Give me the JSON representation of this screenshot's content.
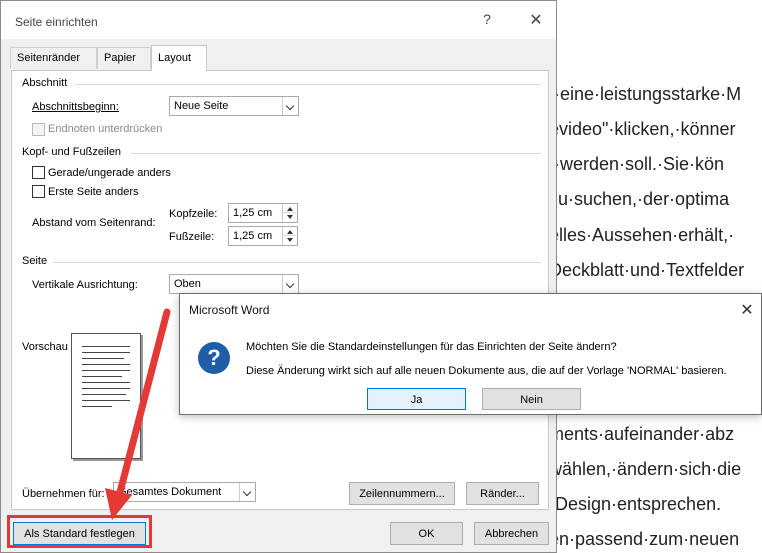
{
  "document": {
    "lines": [
      "t·eine·leistungsstarke·M",
      "evideo\"·klicken,·könner",
      "t·werden·soll.·Sie·kön",
      "zu·suchen,·der·optima",
      "elles·Aussehen·erhält,·",
      "Deckblatt·und·Textfelder",
      "ments·aufeinander·abz",
      "wählen,·ändern·sich·die",
      "·Design·entsprechen.",
      "en·passend·zum·neuen"
    ]
  },
  "dialog": {
    "title": "Seite einrichten",
    "help": "?",
    "close": "✕",
    "tabs": [
      "Seitenränder",
      "Papier",
      "Layout"
    ],
    "section_abschnitt": "Abschnitt",
    "abschnittsbeginn_label": "Abschnittsbeginn:",
    "abschnittsbeginn_value": "Neue Seite",
    "endnoten_label": "Endnoten unterdrücken",
    "section_kopf": "Kopf- und Fußzeilen",
    "gerade_label": "Gerade/ungerade anders",
    "erste_label": "Erste Seite anders",
    "abstand_label": "Abstand vom Seitenrand:",
    "kopfzeile_label": "Kopfzeile:",
    "kopfzeile_value": "1,25 cm",
    "fusszeile_label": "Fußzeile:",
    "fusszeile_value": "1,25 cm",
    "section_seite": "Seite",
    "ausrichtung_label": "Vertikale Ausrichtung:",
    "ausrichtung_value": "Oben",
    "vorschau_label": "Vorschau",
    "uebernehmen_label": "Übernehmen für:",
    "uebernehmen_value": "Gesamtes Dokument",
    "zeilennummern_button": "Zeilennummern...",
    "raender_button": "Ränder...",
    "standard_button": "Als Standard festlegen",
    "ok_button": "OK",
    "cancel_button": "Abbrechen"
  },
  "msgbox": {
    "title": "Microsoft Word",
    "close": "✕",
    "icon": "?",
    "line1": "Möchten Sie die Standardeinstellungen für das Einrichten der Seite ändern?",
    "line2": "Diese Änderung wirkt sich auf alle neuen Dokumente aus, die auf der Vorlage 'NORMAL' basieren.",
    "yes_button": "Ja",
    "no_button": "Nein"
  },
  "colors": {
    "annotation": "#e53935",
    "question_icon": "#1f5da8",
    "default_button_border": "#0078d7"
  }
}
